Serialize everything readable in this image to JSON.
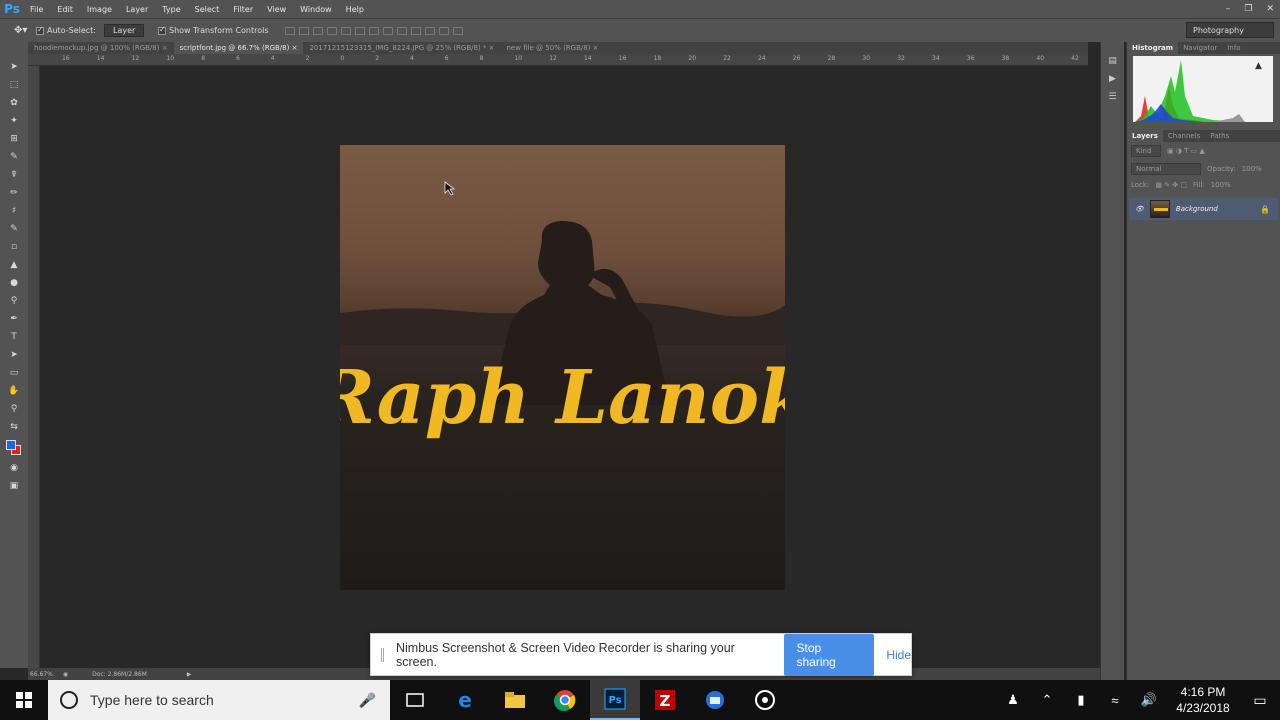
{
  "app": {
    "logo": "Ps",
    "menu": [
      "File",
      "Edit",
      "Image",
      "Layer",
      "Type",
      "Select",
      "Filter",
      "View",
      "Window",
      "Help"
    ]
  },
  "options": {
    "auto_select_label": "Auto-Select:",
    "auto_select_value": "Layer",
    "transform_label": "Show Transform Controls",
    "workspace": "Photography"
  },
  "tabs": [
    {
      "label": "hoodiemockup.jpg @ 100% (RGB/8)"
    },
    {
      "label": "scriptfont.jpg @ 66.7% (RGB/8)"
    },
    {
      "label": "20171215123315_IMG_8224.JPG @ 25% (RGB/8) *"
    },
    {
      "label": "new file @ 50% (RGB/8)"
    }
  ],
  "ruler_labels": [
    "16",
    "14",
    "12",
    "10",
    "8",
    "6",
    "4",
    "2",
    "0",
    "2",
    "4",
    "6",
    "8",
    "10",
    "12",
    "14",
    "16",
    "18",
    "20",
    "22",
    "24",
    "26",
    "28",
    "30",
    "32",
    "34",
    "36",
    "38",
    "40",
    "42"
  ],
  "artwork": {
    "title_text": "Raph Lanok",
    "title_color": "#f0b823",
    "sky_color": "#7a5c45"
  },
  "status": {
    "zoom": "66.67%",
    "doc": "Doc: 2.86M/2.86M"
  },
  "panels": {
    "top_tabs": [
      "Histogram",
      "Navigator",
      "Info"
    ],
    "layer_tabs": [
      "Layers",
      "Channels",
      "Paths"
    ],
    "kind_label": "Kind",
    "blend_mode": "Normal",
    "opacity_label": "Opacity:",
    "opacity_value": "100%",
    "lock_label": "Lock:",
    "fill_label": "Fill:",
    "fill_value": "100%",
    "layer_name": "Background"
  },
  "nimbus": {
    "message": "Nimbus Screenshot & Screen Video Recorder is sharing your screen.",
    "stop_label": "Stop sharing",
    "hide_label": "Hide",
    "stop_color": "#4a8fe7"
  },
  "taskbar": {
    "search_placeholder": "Type here to search",
    "time": "4:16 PM",
    "date": "4/23/2018"
  }
}
